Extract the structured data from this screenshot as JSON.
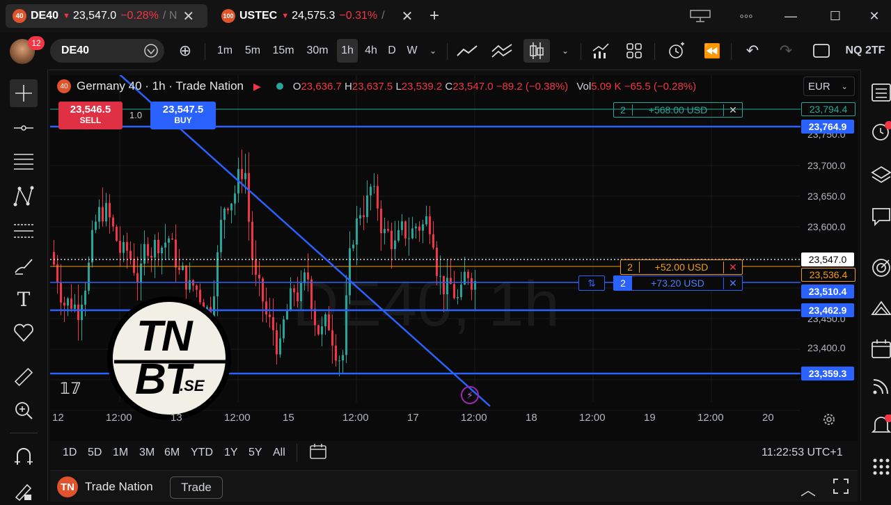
{
  "tabs": [
    {
      "badge": "40",
      "symbol": "DE40",
      "price": "23,547.0",
      "change": "−0.28%",
      "suffix": "/ N"
    },
    {
      "badge": "100",
      "symbol": "USTEC",
      "price": "24,575.3",
      "change": "−0.31%",
      "suffix": "/"
    }
  ],
  "toolbar": {
    "notification_count": "12",
    "symbol": "DE40",
    "intervals": [
      "1m",
      "5m",
      "15m",
      "30m",
      "1h",
      "4h",
      "D",
      "W"
    ],
    "active_interval": "1h",
    "layout_name": "NQ 2TF"
  },
  "chart": {
    "title": "Germany 40 · 1h · Trade Nation",
    "ohlc": {
      "o": "23,636.7",
      "h": "23,637.5",
      "l": "23,539.2",
      "c": "23,547.0",
      "chg": "−89.2 (−0.38%)"
    },
    "volume": {
      "label": "Vol",
      "value": "5.09 K",
      "chg": "−65.5 (−0.28%)"
    },
    "currency": "EUR",
    "watermark": "DE40, 1h",
    "sell": {
      "price": "23,546.5",
      "label": "SELL"
    },
    "buy": {
      "price": "23,547.5",
      "label": "BUY"
    },
    "spread": "1.0",
    "orders": [
      {
        "qty": "2",
        "pnl": "+568.00 USD",
        "color": "#26a69a"
      },
      {
        "qty": "2",
        "pnl": "+52.00 USD",
        "color": "#f39c12"
      },
      {
        "qty": "2",
        "pnl": "+73.20 USD",
        "color": "#2962ff"
      }
    ],
    "price_labels": [
      {
        "text": "23,794.4",
        "kind": "green"
      },
      {
        "text": "23,764.9",
        "kind": "blue"
      },
      {
        "text": "23,547.0",
        "kind": "white"
      },
      {
        "text": "23,536.4",
        "kind": "orange"
      },
      {
        "text": "23,510.4",
        "kind": "blue"
      },
      {
        "text": "23,462.9",
        "kind": "blue"
      },
      {
        "text": "23,359.3",
        "kind": "blue"
      }
    ],
    "y_ticks": [
      "23,750.0",
      "23,700.0",
      "23,650.0",
      "23,600.0",
      "23,450.0",
      "23,400.0"
    ],
    "x_ticks": [
      "12",
      "12:00",
      "13",
      "12:00",
      "15",
      "12:00",
      "17",
      "12:00",
      "18",
      "12:00",
      "19",
      "12:00",
      "20"
    ],
    "logo_text": {
      "line1": "TN",
      "line2": "BT",
      "line3": ".SE"
    }
  },
  "ranges": [
    "1D",
    "5D",
    "1M",
    "3M",
    "6M",
    "YTD",
    "1Y",
    "5Y",
    "All"
  ],
  "clock": "11:22:53 UTC+1",
  "footer": {
    "broker": "Trade Nation",
    "trade_label": "Trade"
  },
  "colors": {
    "up": "#26a69a",
    "down": "#f23645",
    "blue": "#2962ff",
    "orange": "#f39c12"
  }
}
